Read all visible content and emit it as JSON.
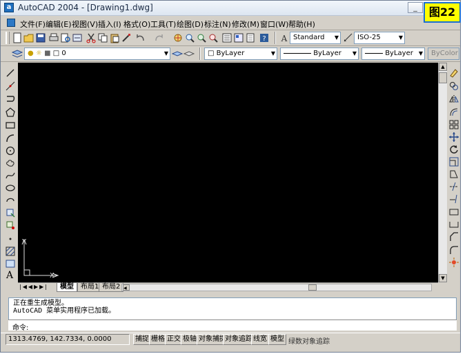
{
  "window": {
    "title": "AutoCAD 2004 - [Drawing1.dwg]",
    "app_icon": "a",
    "figure_tag": "图22",
    "min_label": "_",
    "max_label": "□",
    "close_label": "×"
  },
  "menu": {
    "items": [
      "文件(F)",
      "编辑(E)",
      "视图(V)",
      "插入(I)",
      "格式(O)",
      "工具(T)",
      "绘图(D)",
      "标注(N)",
      "修改(M)",
      "窗口(W)",
      "帮助(H)"
    ]
  },
  "toolbar": {
    "text_style": "Standard",
    "dim_style": "ISO-25"
  },
  "layers": {
    "current_layer": "0",
    "color": "ByLayer",
    "linetype": "ByLayer",
    "lineweight": "ByLayer",
    "plot_style": "ByColor"
  },
  "canvas": {
    "ucs_y": "Y",
    "ucs_x": "X"
  },
  "tabs": {
    "items": [
      "模型",
      "布局1",
      "布局2"
    ],
    "active": "模型"
  },
  "command": {
    "history": [
      "正在重生成模型。",
      "AutoCAD 菜单实用程序已加载。"
    ],
    "prompt": "命令:"
  },
  "status": {
    "coordinates": "1313.4769, 142.7334, 0.0000",
    "buttons": [
      "捕捉",
      "栅格",
      "正交",
      "极轴",
      "对象捕捉",
      "对象追踪",
      "线宽",
      "模型"
    ],
    "watermark": "绿数对象追踪"
  },
  "colors": {
    "canvas_bg": "#000000",
    "chrome": "#d4d0c8",
    "figure_tag_bg": "#ffff00",
    "figure_tag_border": "#1a6fd0"
  }
}
